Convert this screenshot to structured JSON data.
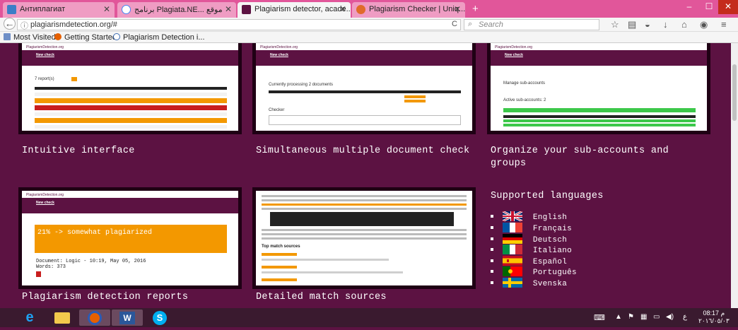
{
  "tabs": [
    {
      "label": "Антиплагиат",
      "favicon_color": "#3b7ec7"
    },
    {
      "label": "برنامج Plagiata.NE... موقع",
      "favicon_color": "#ffffff"
    },
    {
      "label": "Plagiarism detector, acade...",
      "favicon_color": "#5c1242"
    },
    {
      "label": "Plagiarism Checker | Uniq...",
      "favicon_color": "#e06b2a"
    }
  ],
  "window_controls": {
    "minimize": "–",
    "maximize": "☐",
    "close": "✕"
  },
  "nav": {
    "back": "←",
    "info": "ⓘ",
    "url": "plagiarismdetection.org/#",
    "reload": "C",
    "search_placeholder": "Search",
    "toolbar_icons": [
      "bookmark-star-icon",
      "reading-list-icon",
      "pocket-icon",
      "download-icon",
      "home-icon",
      "sync-icon",
      "menu-icon"
    ]
  },
  "bookmarks": [
    {
      "label": "Most Visited",
      "icon": "bookmark-folder-icon"
    },
    {
      "label": "Getting Started",
      "icon": "firefox-icon"
    },
    {
      "label": "Plagiarism Detection i...",
      "icon": "site-icon"
    }
  ],
  "features": [
    {
      "caption": "Intuitive interface"
    },
    {
      "caption": "Simultaneous multiple document check"
    },
    {
      "caption": "Organize your sub-accounts and groups"
    },
    {
      "caption": "Plagiarism detection reports"
    },
    {
      "caption": "Detailed match sources"
    }
  ],
  "thumbnails": {
    "brand": "PlagiarismDetection.org",
    "new_check": "New check",
    "reports": "7 report(s)",
    "processing": "Currently processing 2 documents",
    "checker": "Checker",
    "manage": "Manage sub-accounts",
    "active": "Active sub-accounts: 2",
    "plag_title": "21% -> somewhat plagiarized",
    "doc_line": "Document: Logic - 10:19, May 05, 2016",
    "words_line": "Words: 373",
    "top_match": "Top match sources"
  },
  "languages": {
    "title": "Supported languages",
    "items": [
      {
        "name": "English",
        "flag": "uk"
      },
      {
        "name": "Français",
        "flag": "fr"
      },
      {
        "name": "Deutsch",
        "flag": "de"
      },
      {
        "name": "Italiano",
        "flag": "it"
      },
      {
        "name": "Español",
        "flag": "es"
      },
      {
        "name": "Português",
        "flag": "pt"
      },
      {
        "name": "Svenska",
        "flag": "se"
      }
    ]
  },
  "taskbar": {
    "apps": [
      "ie-icon",
      "file-explorer-icon",
      "firefox-icon",
      "word-icon",
      "skype-icon"
    ],
    "clock_time": "08:17 م",
    "clock_date": "٢٠١٦/٠٥/٠٣"
  },
  "colors": {
    "page_bg": "#5c1242",
    "tab_strip": "#e1569a",
    "accent_orange": "#f39800"
  }
}
